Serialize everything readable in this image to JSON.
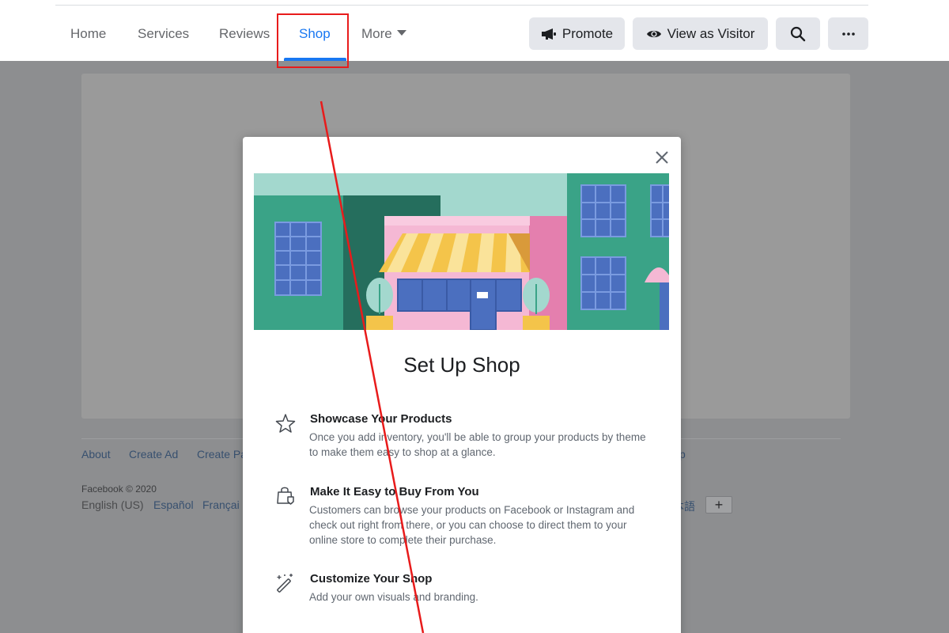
{
  "nav": {
    "tabs": [
      {
        "label": "Home"
      },
      {
        "label": "Services"
      },
      {
        "label": "Reviews"
      },
      {
        "label": "Shop"
      },
      {
        "label": "More"
      }
    ],
    "active_tab": "Shop",
    "buttons": {
      "promote": "Promote",
      "view_as_visitor": "View as Visitor"
    },
    "icons": {
      "promote": "megaphone-icon",
      "view_as_visitor": "eye-icon",
      "search": "search-icon",
      "more": "more-dots-icon",
      "dropdown": "caret-down-icon"
    }
  },
  "footer": {
    "links": [
      "About",
      "Create Ad",
      "Create Pa",
      "p"
    ],
    "copyright": "Facebook © 2020",
    "languages": [
      "English (US)",
      "Español",
      "Françai",
      "本語"
    ],
    "add_language": "+"
  },
  "modal": {
    "title": "Set Up Shop",
    "close_icon": "close-icon",
    "illustration": "storefront-illustration",
    "features": [
      {
        "icon": "star-outline-icon",
        "title": "Showcase Your Products",
        "description": "Once you add inventory, you'll be able to group your products by theme to make them easy to shop at a glance."
      },
      {
        "icon": "shopping-bag-icon",
        "title": "Make It Easy to Buy From You",
        "description": "Customers can browse your products on Facebook or Instagram and check out right from there, or you can choose to direct them to your online store to complete their purchase."
      },
      {
        "icon": "magic-wand-icon",
        "title": "Customize Your Shop",
        "description": "Add your own visuals and branding."
      }
    ]
  },
  "colors": {
    "accent": "#1877f2",
    "annotation": "#e81b1b",
    "overlay": "#8d8e90"
  }
}
